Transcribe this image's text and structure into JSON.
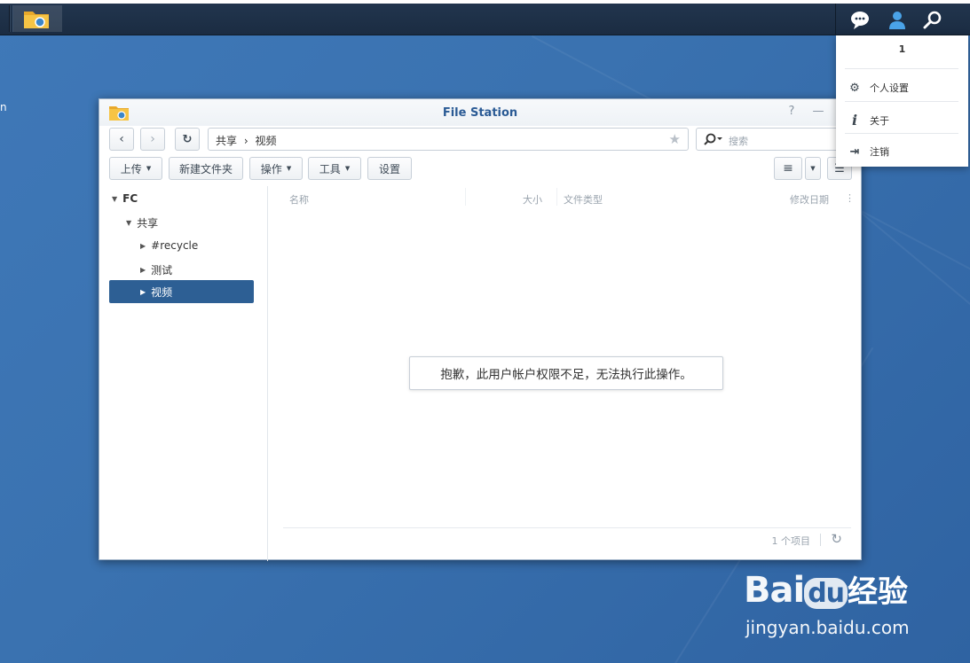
{
  "desktop": {
    "edge_text": "n"
  },
  "window": {
    "title": "File Station",
    "controls": [
      "?",
      "—",
      "□"
    ]
  },
  "nav": {
    "path_root": "共享",
    "path_sep": "›",
    "path_current": "视频",
    "search_placeholder": "搜索"
  },
  "toolbar": {
    "upload": "上传",
    "new_folder": "新建文件夹",
    "action": "操作",
    "tools": "工具",
    "settings": "设置"
  },
  "tree": {
    "root": "FC",
    "shared": "共享",
    "children": [
      "#recycle",
      "测试",
      "视频"
    ],
    "selected": "视频"
  },
  "columns": {
    "name": "名称",
    "size": "大小",
    "type": "文件类型",
    "modified": "修改日期"
  },
  "message": "抱歉，此用户帐户权限不足，无法执行此操作。",
  "footer": {
    "count": "1 个项目"
  },
  "user_menu": {
    "username": "1",
    "personal_settings": "个人设置",
    "about": "关于",
    "logout": "注销"
  },
  "watermark": {
    "brand": "Bai",
    "brand2": "du",
    "cn": "经验",
    "url": "jingyan.baidu.com"
  },
  "colors": {
    "accent": "#2d5f94",
    "title": "#2b5b95",
    "desktop": "#3a72b0",
    "taskbar": "#1e3148"
  }
}
